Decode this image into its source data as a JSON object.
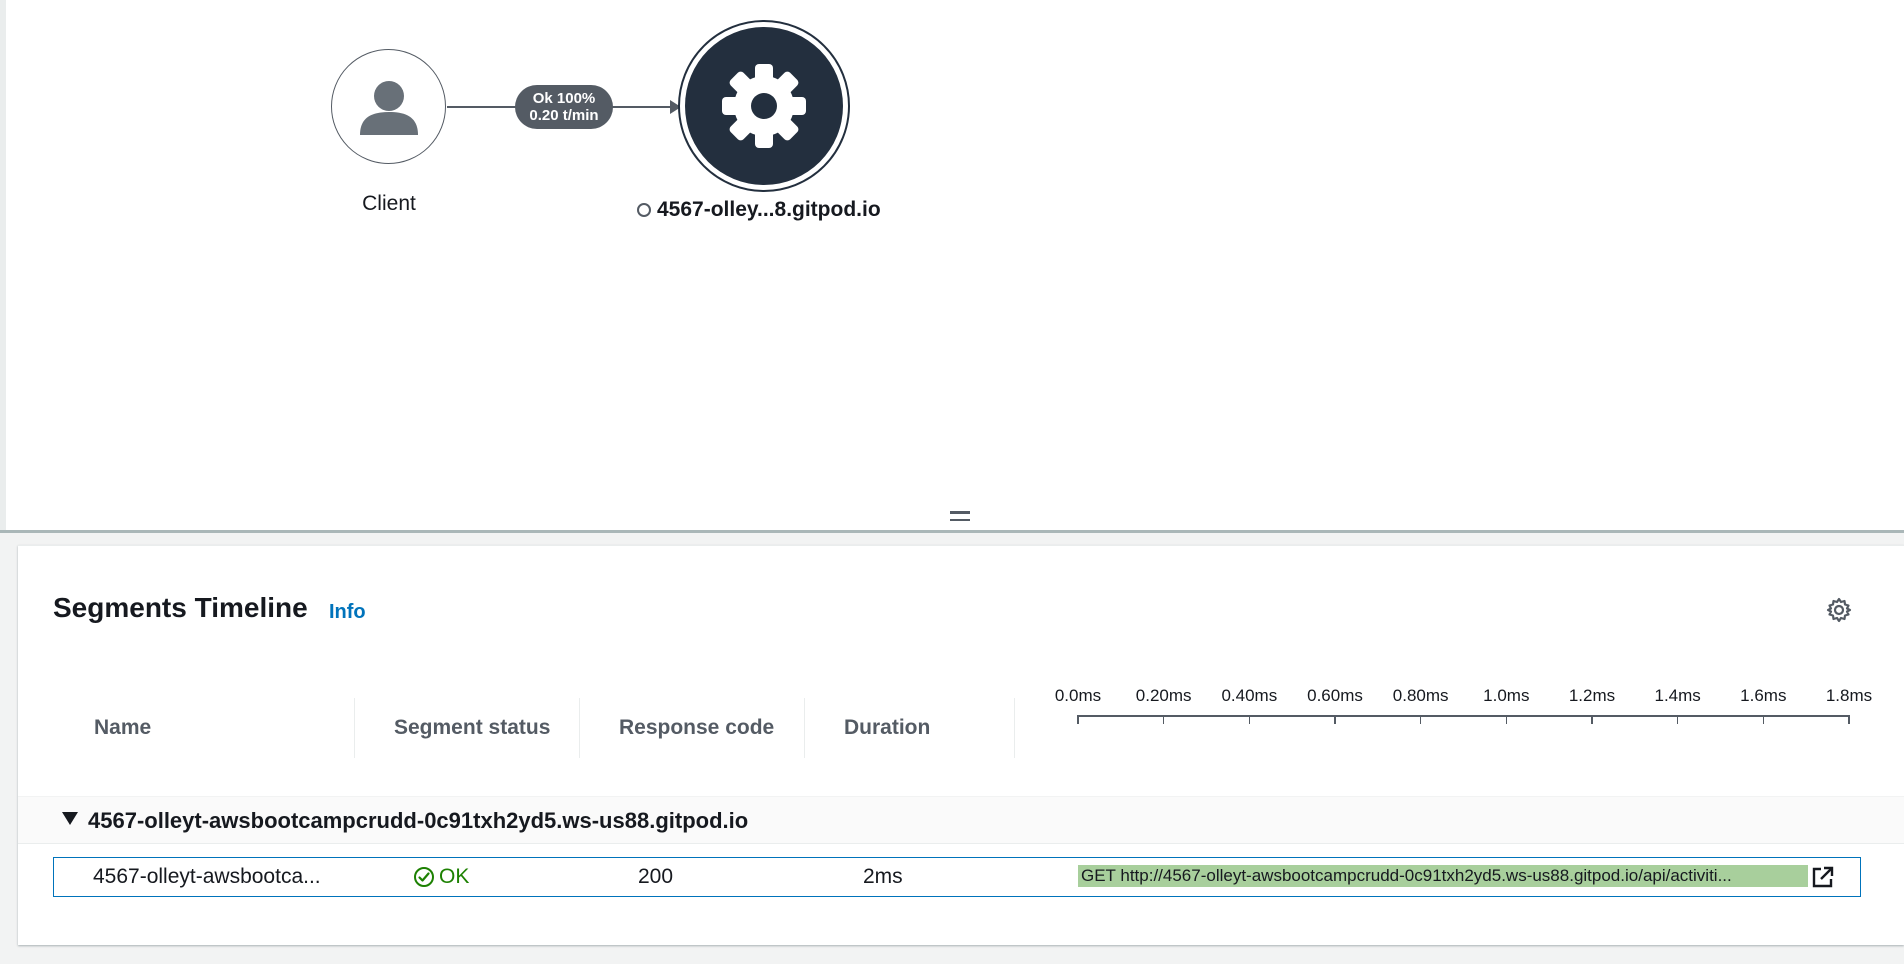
{
  "service_map": {
    "client_label": "Client",
    "edge_line1": "Ok 100%",
    "edge_line2": "0.20 t/min",
    "service_label": "4567-olley...8.gitpod.io"
  },
  "segments": {
    "title": "Segments Timeline",
    "info_label": "Info",
    "columns": {
      "name": "Name",
      "status": "Segment status",
      "code": "Response code",
      "duration": "Duration"
    },
    "axis_ticks": [
      "0.0ms",
      "0.20ms",
      "0.40ms",
      "0.60ms",
      "0.80ms",
      "1.0ms",
      "1.2ms",
      "1.4ms",
      "1.6ms",
      "1.8ms"
    ],
    "group": {
      "name": "4567-olleyt-awsbootcampcrudd-0c91txh2yd5.ws-us88.gitpod.io"
    },
    "row": {
      "name": "4567-olleyt-awsbootca...",
      "status": "OK",
      "code": "200",
      "duration": "2ms",
      "bar_label": "GET http://4567-olleyt-awsbootcampcrudd-0c91txh2yd5.ws-us88.gitpod.io/api/activiti..."
    }
  },
  "colors": {
    "service_node": "#232f3e",
    "edge": "#545b64",
    "ok_green": "#1d8102",
    "bar_fill": "#a8cf9c",
    "link_blue": "#0073bb"
  }
}
